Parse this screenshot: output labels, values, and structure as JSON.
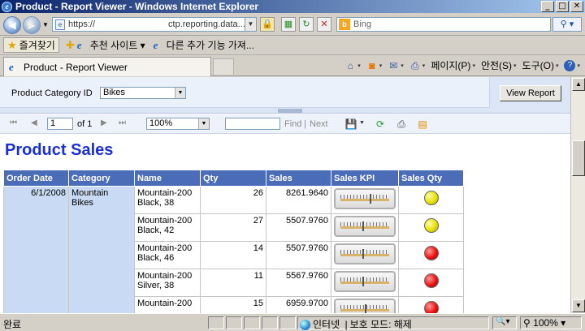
{
  "window": {
    "title": "Product - Report Viewer - Windows Internet Explorer",
    "minimize": "_",
    "maximize": "□",
    "close": "✕"
  },
  "address": {
    "url_prefix": "https://",
    "url_rest": "ctp.reporting.data...",
    "search_placeholder": "Bing"
  },
  "favorites": {
    "label": "즐겨찾기",
    "items": [
      "추천 사이트 ▾",
      "다른 추가 기능 가져..."
    ]
  },
  "tab": {
    "title": "Product - Report Viewer"
  },
  "commands": {
    "page": "페이지(P)",
    "safety": "안전(S)",
    "tools": "도구(O)"
  },
  "params": {
    "label": "Product Category ID",
    "value": "Bikes",
    "view_report": "View Report"
  },
  "toolbar": {
    "page_value": "1",
    "of_text": "of 1",
    "zoom": "100%",
    "find": "Find",
    "separator": "|",
    "next": "Next"
  },
  "report": {
    "title": "Product Sales",
    "columns": [
      "Order Date",
      "Category",
      "Name",
      "Qty",
      "Sales",
      "Sales KPI",
      "Sales Qty"
    ],
    "order_date": "6/1/2008",
    "category": "Mountain Bikes",
    "rows": [
      {
        "name": "Mountain-200 Black, 38",
        "qty": "26",
        "sales": "8261.9640",
        "kpi": 0.6,
        "status": "yellow"
      },
      {
        "name": "Mountain-200 Black, 42",
        "qty": "27",
        "sales": "5507.9760",
        "kpi": 0.45,
        "status": "yellow"
      },
      {
        "name": "Mountain-200 Black, 46",
        "qty": "14",
        "sales": "5507.9760",
        "kpi": 0.45,
        "status": "red"
      },
      {
        "name": "Mountain-200 Silver, 38",
        "qty": "11",
        "sales": "5567.9760",
        "kpi": 0.45,
        "status": "red"
      },
      {
        "name": "Mountain-200",
        "qty": "15",
        "sales": "6959.9700",
        "kpi": 0.5,
        "status": "red"
      }
    ]
  },
  "status": {
    "left": "완료",
    "zone": "인터넷",
    "protected": "보호 모드: 해제",
    "zoom": "100%"
  },
  "colors": {
    "header_bg": "#4b6cb7",
    "title_blue": "#1a2fd4",
    "group_bg": "#c9daf5"
  }
}
